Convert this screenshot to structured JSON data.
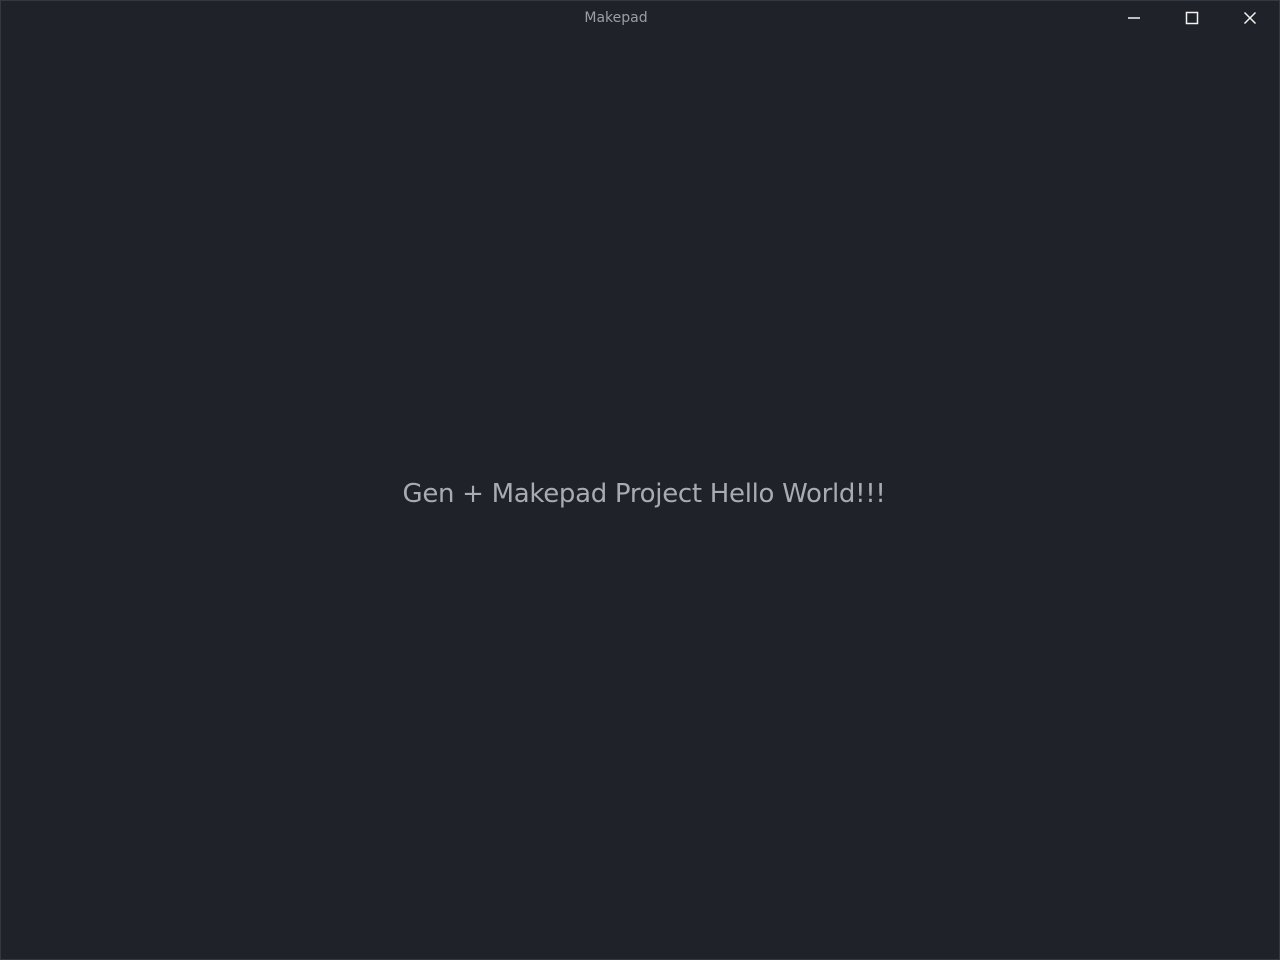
{
  "window": {
    "title": "Makepad",
    "controls": {
      "minimize_icon": "minimize-icon",
      "maximize_icon": "maximize-icon",
      "close_icon": "close-icon"
    }
  },
  "main": {
    "label": "Gen + Makepad Project Hello World!!!"
  },
  "colors": {
    "background": "#1f2228",
    "title_text": "#9a9ea6",
    "label_text": "#a7abb2",
    "icon": "#f2f2f2"
  }
}
